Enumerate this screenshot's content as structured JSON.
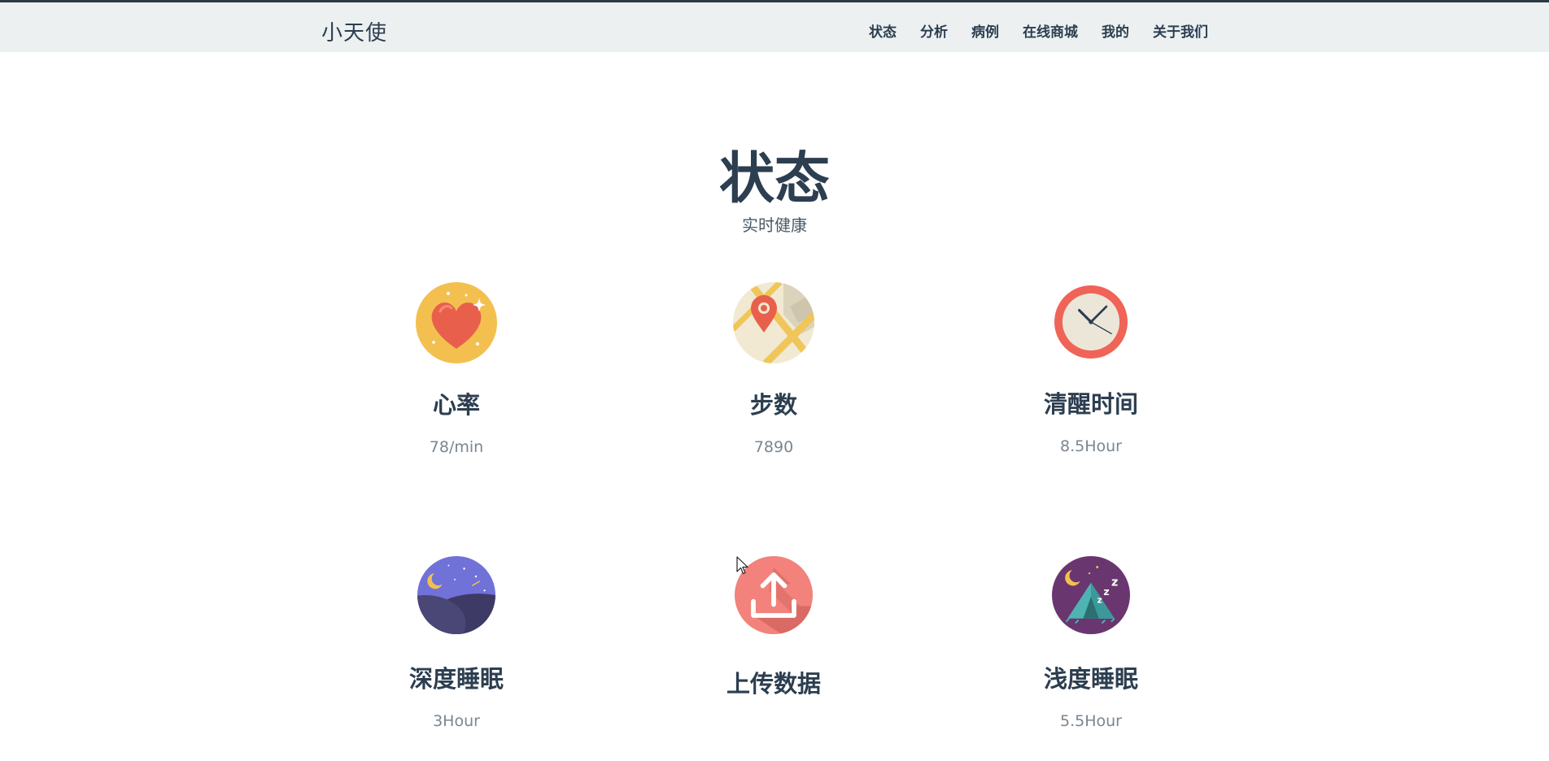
{
  "header": {
    "brand": "小天使",
    "nav": [
      "状态",
      "分析",
      "病例",
      "在线商城",
      "我的",
      "关于我们"
    ]
  },
  "section": {
    "title": "状态",
    "subtitle": "实时健康"
  },
  "cards": [
    {
      "title": "心率",
      "value": "78/min",
      "icon": "heart-icon"
    },
    {
      "title": "步数",
      "value": "7890",
      "icon": "map-pin-icon"
    },
    {
      "title": "清醒时间",
      "value": "8.5Hour",
      "icon": "clock-icon"
    },
    {
      "title": "深度睡眠",
      "value": "3Hour",
      "icon": "night-sky-icon"
    },
    {
      "title": "上传数据",
      "value": "",
      "icon": "upload-icon"
    },
    {
      "title": "浅度睡眠",
      "value": "5.5Hour",
      "icon": "tent-sleep-icon"
    }
  ],
  "colors": {
    "navbar_bg": "#ecf0f1",
    "text_primary": "#2c3e50",
    "text_muted": "#7a8691",
    "heart_bg": "#f3c04f",
    "heart": "#e8604c",
    "clock_ring": "#f06357",
    "night_bg": "#7072d8",
    "upload_bg": "#f2827b",
    "tent_bg": "#6a3670"
  }
}
